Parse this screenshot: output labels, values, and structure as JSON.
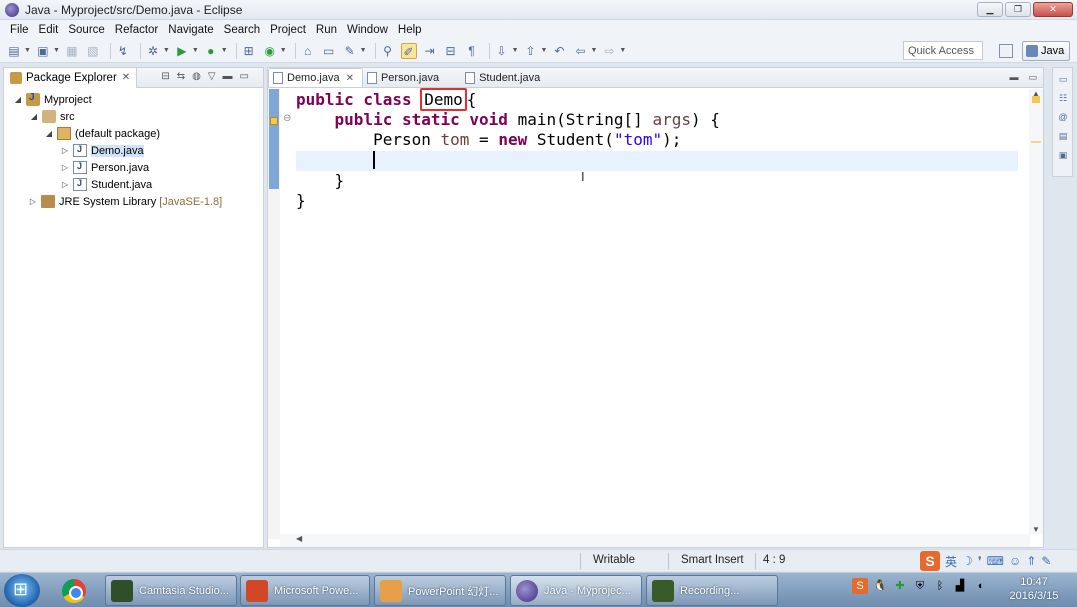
{
  "window": {
    "title": "Java - Myproject/src/Demo.java - Eclipse",
    "controls": [
      "▁",
      "❐",
      "✕"
    ]
  },
  "menu": [
    "File",
    "Edit",
    "Source",
    "Refactor",
    "Navigate",
    "Search",
    "Project",
    "Run",
    "Window",
    "Help"
  ],
  "toolbar": {
    "quick_access": "Quick Access",
    "perspective": "Java"
  },
  "package_explorer": {
    "title": "Package Explorer",
    "tree": {
      "project": "Myproject",
      "src": "src",
      "package": "(default package)",
      "files": [
        "Demo.java",
        "Person.java",
        "Student.java"
      ],
      "library": "JRE System Library",
      "library_version": "[JavaSE-1.8]"
    }
  },
  "editor": {
    "tabs": [
      "Demo.java",
      "Person.java",
      "Student.java"
    ],
    "active_tab": "Demo.java",
    "code": {
      "l1_kw": "public class",
      "l1_cls": "Demo",
      "l1_brace": "{",
      "l2_kw": "public static void",
      "l2_rest": "main(String[]",
      "l2_param": "args",
      "l2_end": ") {",
      "l3_type": "Person",
      "l3_var": "tom",
      "l3_eq": "=",
      "l3_new": "new",
      "l3_ctor": "Student(",
      "l3_str": "\"tom\"",
      "l3_end": ");",
      "l5": "}",
      "l6": "}"
    }
  },
  "status": {
    "mode": "Writable",
    "insert": "Smart Insert",
    "position": "4 : 9"
  },
  "ime": {
    "logo": "S",
    "lang": "英"
  },
  "taskbar": {
    "tasks": [
      "Camtasia Studio...",
      "Microsoft Powe...",
      "PowerPoint 幻灯...",
      "Java - Myprojec...",
      "Recording..."
    ],
    "time": "10:47",
    "date": "2016/3/15"
  }
}
